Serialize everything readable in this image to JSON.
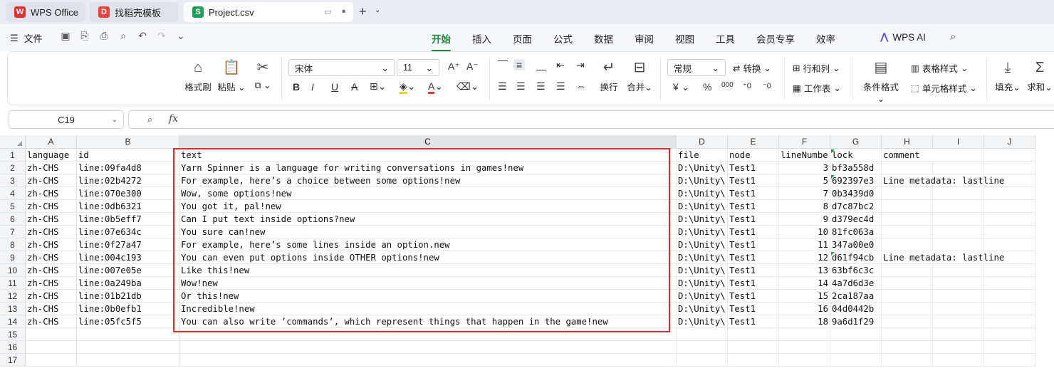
{
  "tabs": [
    {
      "label": "WPS Office",
      "icon": "wps-logo-icon"
    },
    {
      "label": "找稻壳模板",
      "icon": "docer-icon"
    },
    {
      "label": "Project.csv",
      "icon": "spreadsheet-icon"
    }
  ],
  "menu": {
    "file_label": "文件",
    "tabs": [
      "开始",
      "插入",
      "页面",
      "公式",
      "数据",
      "审阅",
      "视图",
      "工具",
      "会员专享",
      "效率"
    ],
    "active_tab": "开始",
    "ai_label": "WPS AI"
  },
  "ribbon": {
    "format_painter": "格式刷",
    "paste": "粘贴",
    "font_name": "宋体",
    "font_size": "11",
    "wrap": "换行",
    "merge": "合并",
    "number_format": "常规",
    "convert": "转换",
    "row_col": "行和列",
    "worksheet": "工作表",
    "conditional_format": "条件格式",
    "table_style": "表格样式",
    "cell_style": "单元格样式",
    "fill": "填充",
    "sum": "求和"
  },
  "formula_bar": {
    "cell_ref": "C19",
    "fx_label": "fx",
    "formula": ""
  },
  "columns": [
    "A",
    "B",
    "C",
    "D",
    "E",
    "F",
    "G",
    "H",
    "I",
    "J"
  ],
  "selected_column": "C",
  "row_numbers": [
    "1",
    "2",
    "3",
    "4",
    "5",
    "6",
    "7",
    "8",
    "9",
    "10",
    "11",
    "12",
    "13",
    "14",
    "15",
    "16",
    "17"
  ],
  "rows": [
    [
      "language",
      "id",
      "text",
      "file",
      "node",
      "lineNumbe",
      "lock",
      "comment"
    ],
    [
      "zh-CHS",
      "line:09fa4d8",
      "Yarn Spinner is a language for writing conversations in games!new",
      "D:\\Unity\\",
      "Test1",
      "3",
      "bf3a558d",
      ""
    ],
    [
      "zh-CHS",
      "line:02b4272",
      "For example, here’s a choice between some options!new",
      "D:\\Unity\\",
      "Test1",
      "5",
      "692397e3",
      "Line metadata: lastline"
    ],
    [
      "zh-CHS",
      "line:070e300",
      "Wow, some options!new",
      "D:\\Unity\\",
      "Test1",
      "7",
      "0b3439d0",
      ""
    ],
    [
      "zh-CHS",
      "line:0db6321",
      "You got it, pal!new",
      "D:\\Unity\\",
      "Test1",
      "8",
      "d7c87bc2",
      ""
    ],
    [
      "zh-CHS",
      "line:0b5eff7",
      "Can I put text inside options?new",
      "D:\\Unity\\",
      "Test1",
      "9",
      "d379ec4d",
      ""
    ],
    [
      "zh-CHS",
      "line:07e634c",
      "You sure can!new",
      "D:\\Unity\\",
      "Test1",
      "10",
      "81fc063a",
      ""
    ],
    [
      "zh-CHS",
      "line:0f27a47",
      "For example, here’s some lines inside an option.new",
      "D:\\Unity\\",
      "Test1",
      "11",
      "347a00e0",
      ""
    ],
    [
      "zh-CHS",
      "line:004c193",
      "You can even put options inside OTHER options!new",
      "D:\\Unity\\",
      "Test1",
      "12",
      "d61f94cb",
      "Line metadata: lastline"
    ],
    [
      "zh-CHS",
      "line:007e05e",
      "Like this!new",
      "D:\\Unity\\",
      "Test1",
      "13",
      "63bf6c3c",
      ""
    ],
    [
      "zh-CHS",
      "line:0a249ba",
      "Wow!new",
      "D:\\Unity\\",
      "Test1",
      "14",
      "4a7d6d3e",
      ""
    ],
    [
      "zh-CHS",
      "line:01b21db",
      "Or this!new",
      "D:\\Unity\\",
      "Test1",
      "15",
      "2ca187aa",
      ""
    ],
    [
      "zh-CHS",
      "line:0b0efb1",
      "Incredible!new",
      "D:\\Unity\\",
      "Test1",
      "16",
      "04d0442b",
      ""
    ],
    [
      "zh-CHS",
      "line:05fc5f5",
      "You can also write ’commands’, which represent things that happen in the game!new",
      "D:\\Unity\\",
      "Test1",
      "18",
      "9a6d1f29",
      ""
    ]
  ],
  "colors": {
    "accent": "#1a8a3a",
    "highlight_box": "#d62f2f",
    "wps_red": "#e0312f",
    "sheet_green": "#1e9e57",
    "ai_purple": "#5b4bd6"
  }
}
